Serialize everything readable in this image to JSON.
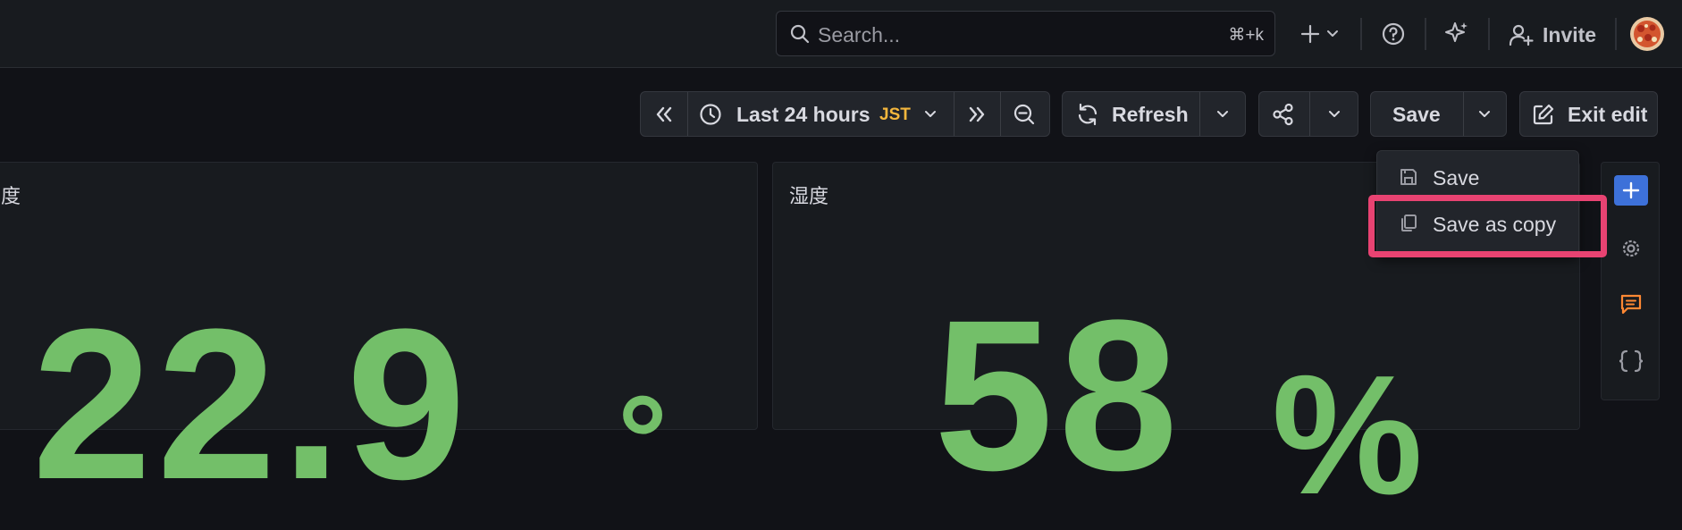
{
  "search": {
    "placeholder": "Search...",
    "shortcut": "⌘+k"
  },
  "nav": {
    "invite_label": "Invite"
  },
  "toolbar": {
    "time_range": "Last 24 hours",
    "timezone": "JST",
    "refresh_label": "Refresh",
    "save_label": "Save",
    "exit_edit_label": "Exit edit"
  },
  "save_menu": {
    "items": [
      {
        "label": "Save"
      },
      {
        "label": "Save as copy"
      }
    ]
  },
  "panels": [
    {
      "title_fragment": "度",
      "value": "22.9",
      "unit": "°"
    },
    {
      "title": "湿度",
      "value": "58",
      "unit": "%"
    }
  ],
  "colors": {
    "accent": "#3d71d9",
    "value_green": "#73bf69",
    "highlight": "#e84372",
    "timezone": "#f5b73d",
    "comment_icon": "#ff8833"
  }
}
